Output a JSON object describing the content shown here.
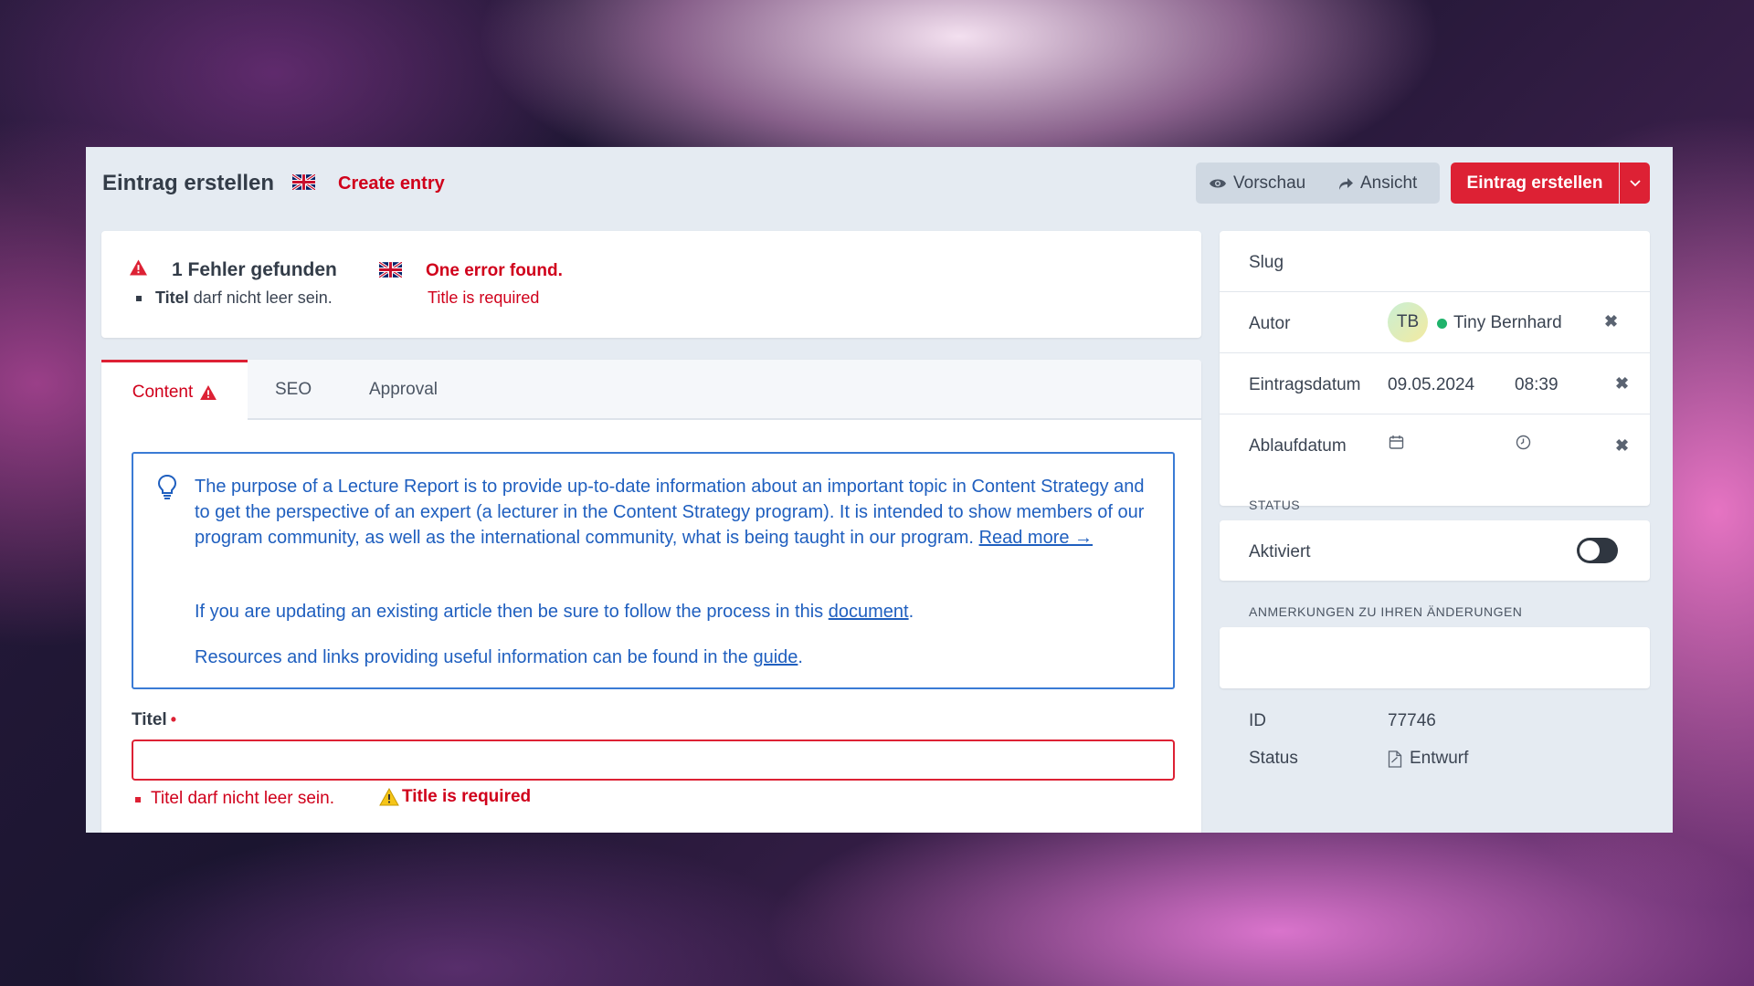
{
  "header": {
    "title": "Eintrag erstellen",
    "title_en": "Create entry",
    "preview_label": "Vorschau",
    "view_label": "Ansicht",
    "create_label": "Eintrag erstellen"
  },
  "errors": {
    "heading": "1 Fehler gefunden",
    "heading_en": "One error found.",
    "item_field": "Titel",
    "item_text": "darf nicht leer sein.",
    "item_en": "Title is required"
  },
  "tabs": [
    {
      "label": "Content",
      "active": true
    },
    {
      "label": "SEO"
    },
    {
      "label": "Approval"
    }
  ],
  "info": {
    "p1": "The purpose of a Lecture Report is to provide up-to-date information about an important topic in Content Strategy and to get the perspective of an expert (a lecturer in the Content Strategy program). It is intended to show members of our program community, as well as the international community, what is being taught in our program.",
    "p1_link": "Read more →",
    "p2": "If you are updating an existing article then be sure to follow the process in this",
    "p2_link": "document",
    "p2_end": ".",
    "p3": "Resources and links providing useful information can be found in the",
    "p3_link": "guide",
    "p3_end": "."
  },
  "title_field": {
    "label": "Titel",
    "required_mark": "•",
    "value": "",
    "error": "Titel darf nicht leer sein.",
    "error_en": "Title is required"
  },
  "sidebar": {
    "slug_label": "Slug",
    "author_label": "Autor",
    "author_initials": "TB",
    "author_name": "Tiny Bernhard",
    "entry_date_label": "Eintragsdatum",
    "entry_date": "09.05.2024",
    "entry_time": "08:39",
    "expiry_date_label": "Ablaufdatum",
    "status_section": "STATUS",
    "enabled_label": "Aktiviert",
    "enabled": false,
    "notes_section": "ANMERKUNGEN ZU IHREN ÄNDERUNGEN",
    "id_label": "ID",
    "id_value": "77746",
    "status_label": "Status",
    "status_value": "Entwurf"
  },
  "colors": {
    "accent_red": "#dd2134",
    "link_blue": "#1f5fbf",
    "online_green": "#1fb36b"
  }
}
